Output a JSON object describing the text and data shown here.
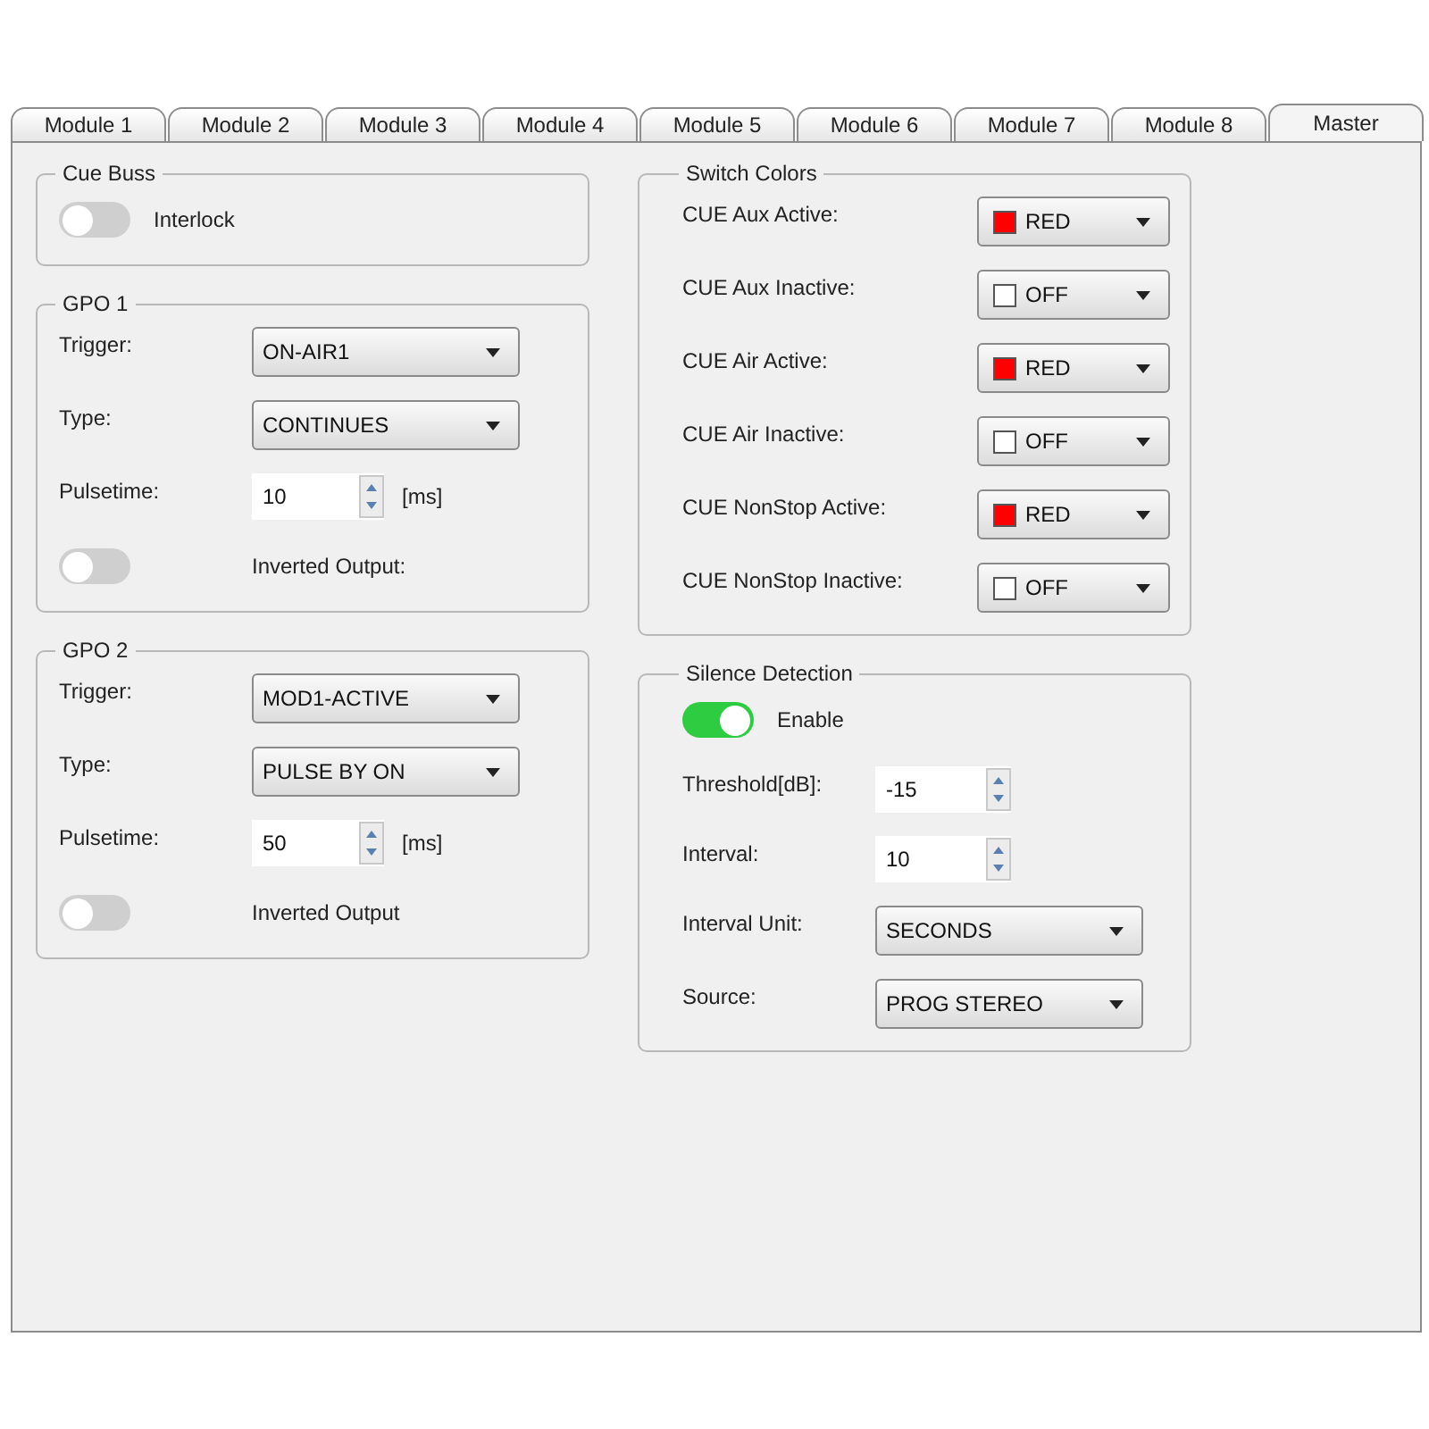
{
  "tabs": [
    {
      "label": "Module 1",
      "selected": false
    },
    {
      "label": "Module 2",
      "selected": false
    },
    {
      "label": "Module 3",
      "selected": false
    },
    {
      "label": "Module 4",
      "selected": false
    },
    {
      "label": "Module 5",
      "selected": false
    },
    {
      "label": "Module 6",
      "selected": false
    },
    {
      "label": "Module 7",
      "selected": false
    },
    {
      "label": "Module 8",
      "selected": false
    },
    {
      "label": "Master",
      "selected": true
    }
  ],
  "left_column": [
    {
      "title": "Cue Buss",
      "rows": [
        {
          "kind": "switch",
          "label": "Interlock",
          "on": false
        }
      ]
    },
    {
      "title": "GPO 1",
      "rows": [
        {
          "kind": "select",
          "label": "Trigger:",
          "value": "ON-AIR1"
        },
        {
          "kind": "select",
          "label": "Type:",
          "value": "CONTINUES"
        },
        {
          "kind": "spin",
          "label": "Pulsetime:",
          "value": "10",
          "unit": "[ms]"
        },
        {
          "kind": "switch",
          "label": "Inverted Output:",
          "on": false
        }
      ]
    },
    {
      "title": "GPO 2",
      "rows": [
        {
          "kind": "select",
          "label": "Trigger:",
          "value": "MOD1-ACTIVE"
        },
        {
          "kind": "select",
          "label": "Type:",
          "value": "PULSE BY ON"
        },
        {
          "kind": "spin",
          "label": "Pulsetime:",
          "value": "50",
          "unit": "[ms]"
        },
        {
          "kind": "switch",
          "label": "Inverted Output",
          "on": false
        }
      ]
    }
  ],
  "right_column": [
    {
      "title": "Switch Colors",
      "rows": [
        {
          "kind": "color_select",
          "label": "CUE Aux Active:",
          "value": "RED",
          "color": "#ff0000"
        },
        {
          "kind": "color_select",
          "label": "CUE Aux Inactive:",
          "value": "OFF",
          "color": "#ffffff"
        },
        {
          "kind": "color_select",
          "label": "CUE Air Active:",
          "value": "RED",
          "color": "#ff0000"
        },
        {
          "kind": "color_select",
          "label": "CUE Air Inactive:",
          "value": "OFF",
          "color": "#ffffff"
        },
        {
          "kind": "color_select",
          "label": "CUE NonStop Active:",
          "value": "RED",
          "color": "#ff0000"
        },
        {
          "kind": "color_select",
          "label": "CUE NonStop Inactive:",
          "value": "OFF",
          "color": "#ffffff"
        }
      ]
    },
    {
      "title": "Silence Detection",
      "rows": [
        {
          "kind": "switch",
          "label": "Enable",
          "on": true
        },
        {
          "kind": "spin",
          "label": "Threshold[dB]:",
          "value": "-15"
        },
        {
          "kind": "spin",
          "label": "Interval:",
          "value": "10"
        },
        {
          "kind": "select",
          "label": "Interval Unit:",
          "value": "SECONDS"
        },
        {
          "kind": "select",
          "label": "Source:",
          "value": "PROG STEREO"
        }
      ]
    }
  ]
}
